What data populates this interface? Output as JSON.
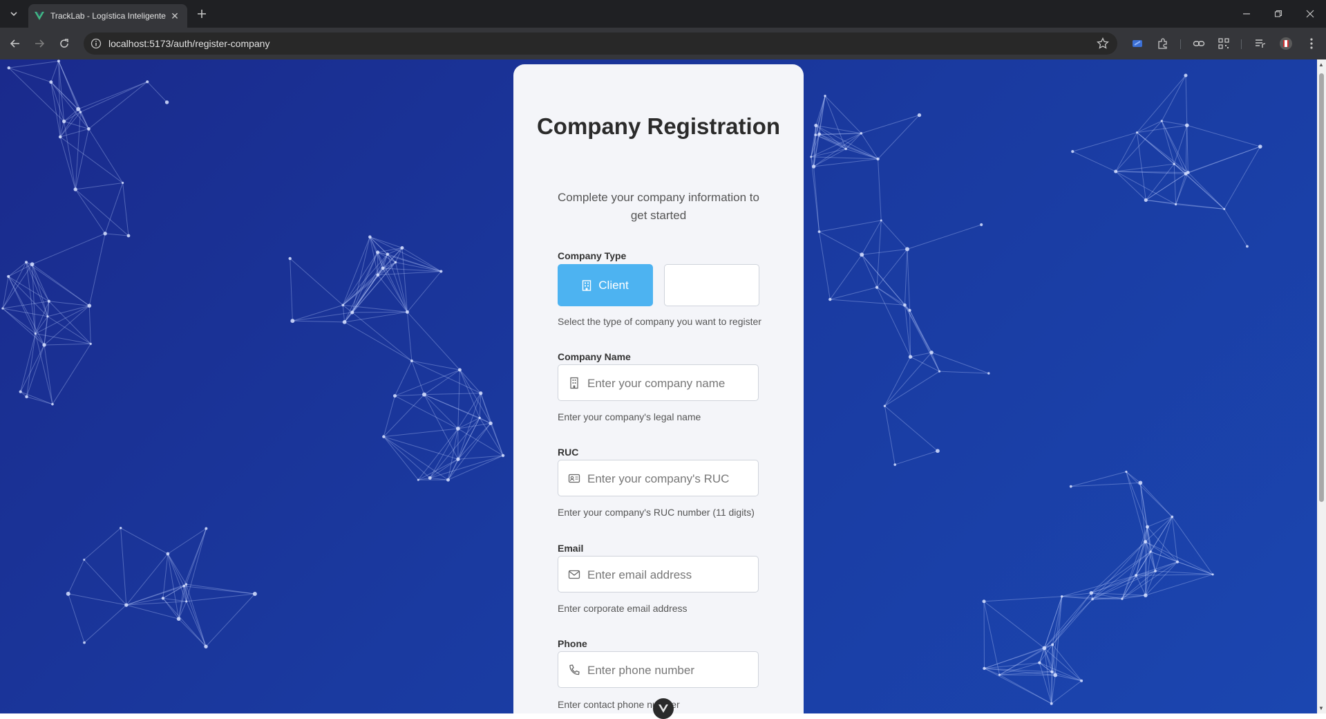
{
  "browser": {
    "tab_title": "TrackLab - Logística Inteligente",
    "url": "localhost:5173/auth/register-company"
  },
  "card": {
    "title": "Company Registration",
    "subtitle": "Complete your company information to get started",
    "company_type": {
      "label": "Company Type",
      "options": [
        {
          "label": "Client",
          "icon": "building-icon",
          "selected": true
        },
        {
          "label": "",
          "selected": false
        }
      ],
      "hint": "Select the type of company you want to register"
    },
    "company_name": {
      "label": "Company Name",
      "placeholder": "Enter your company name",
      "value": "",
      "hint": "Enter your company's legal name",
      "icon": "building-icon"
    },
    "ruc": {
      "label": "RUC",
      "placeholder": "Enter your company's RUC",
      "value": "",
      "hint": "Enter your company's RUC number (11 digits)",
      "icon": "id-card-icon"
    },
    "email": {
      "label": "Email",
      "placeholder": "Enter email address",
      "value": "",
      "hint": "Enter corporate email address",
      "icon": "envelope-icon"
    },
    "phone": {
      "label": "Phone",
      "placeholder": "Enter phone number",
      "value": "",
      "hint": "Enter contact phone number",
      "icon": "phone-icon"
    }
  },
  "colors": {
    "background": "#1a3aa0",
    "selected_button": "#4db3f1",
    "card": "#f4f5f9"
  }
}
